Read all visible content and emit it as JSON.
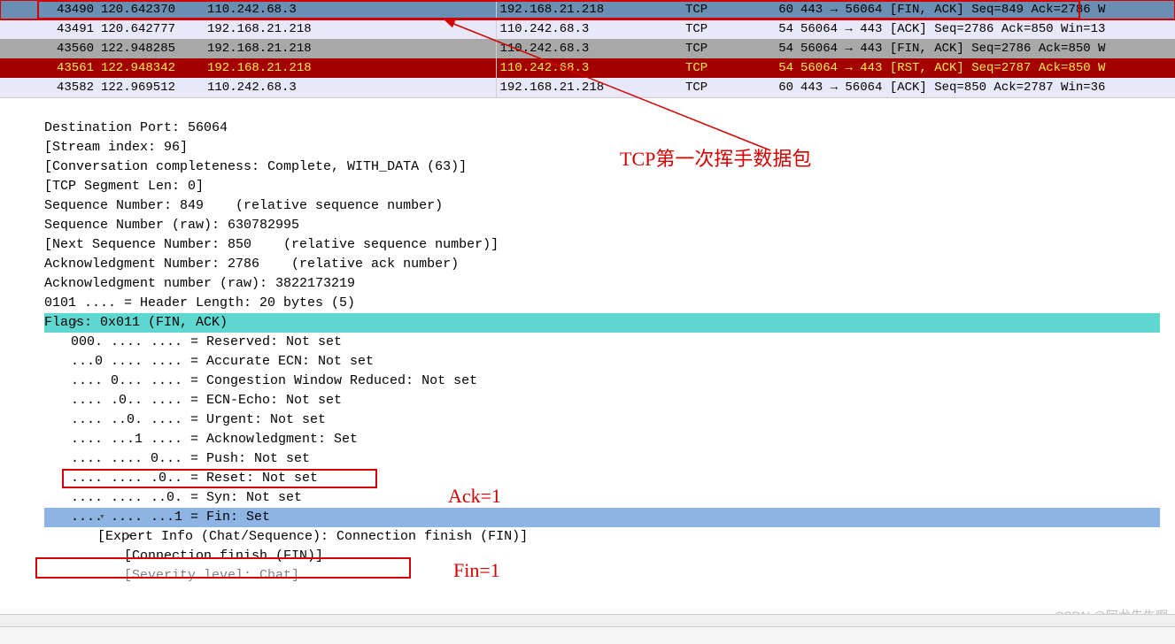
{
  "packets": [
    {
      "cls": "row-selected selected-border",
      "no": "43490",
      "time": "120.642370",
      "src": "110.242.68.3",
      "dst": "192.168.21.218",
      "proto": "TCP",
      "len": "60",
      "info": "443 → 56064 [FIN, ACK] Seq=849  Ack=2786 W"
    },
    {
      "cls": "row-normal",
      "no": "43491",
      "time": "120.642777",
      "src": "192.168.21.218",
      "dst": "110.242.68.3",
      "proto": "TCP",
      "len": "54",
      "info": "56064 → 443 [ACK] Seq=2786 Ack=850 Win=13"
    },
    {
      "cls": "row-gray",
      "no": "43560",
      "time": "122.948285",
      "src": "192.168.21.218",
      "dst": "110.242.68.3",
      "proto": "TCP",
      "len": "54",
      "info": "56064 → 443 [FIN, ACK] Seq=2786 Ack=850 W"
    },
    {
      "cls": "row-red",
      "no": "43561",
      "time": "122.948342",
      "src": "192.168.21.218",
      "dst": "110.242.68.3",
      "proto": "TCP",
      "len": "54",
      "info": "56064 → 443 [RST, ACK] Seq=2787 Ack=850 W"
    },
    {
      "cls": "row-normal",
      "no": "43582",
      "time": "122.969512",
      "src": "110.242.68.3",
      "dst": "192.168.21.218",
      "proto": "TCP",
      "len": "60",
      "info": "443 → 56064 [ACK] Seq=850 Ack=2787 Win=36"
    }
  ],
  "details": {
    "dest_port": "Destination Port: 56064",
    "stream": "[Stream index: 96]",
    "conv": "[Conversation completeness: Complete, WITH_DATA (63)]",
    "seglen": "[TCP Segment Len: 0]",
    "seqnum": "Sequence Number: 849    (relative sequence number)",
    "seqraw": "Sequence Number (raw): 630782995",
    "nextseq": "[Next Sequence Number: 850    (relative sequence number)]",
    "acknum": "Acknowledgment Number: 2786    (relative ack number)",
    "ackraw": "Acknowledgment number (raw): 3822173219",
    "hdrlen": "0101 .... = Header Length: 20 bytes (5)",
    "flags": "Flags: 0x011 (FIN, ACK)",
    "f_res": "000. .... .... = Reserved: Not set",
    "f_aec": "...0 .... .... = Accurate ECN: Not set",
    "f_cwr": ".... 0... .... = Congestion Window Reduced: Not set",
    "f_ece": ".... .0.. .... = ECN-Echo: Not set",
    "f_urg": ".... ..0. .... = Urgent: Not set",
    "f_ack": ".... ...1 .... = Acknowledgment: Set",
    "f_psh": ".... .... 0... = Push: Not set",
    "f_rst": ".... .... .0.. = Reset: Not set",
    "f_syn": ".... .... ..0. = Syn: Not set",
    "f_fin": ".... .... ...1 = Fin: Set",
    "expert": "[Expert Info (Chat/Sequence): Connection finish (FIN)]",
    "connfin": "[Connection finish (FIN)]",
    "sev": "[Severity level: Chat]"
  },
  "annotations": {
    "title": "TCP第一次挥手数据包",
    "ack": "Ack=1",
    "fin": "Fin=1"
  },
  "watermark": "CSDN @阿龙先生啊",
  "statusbar_left": "  ",
  "statusbar_right": " "
}
